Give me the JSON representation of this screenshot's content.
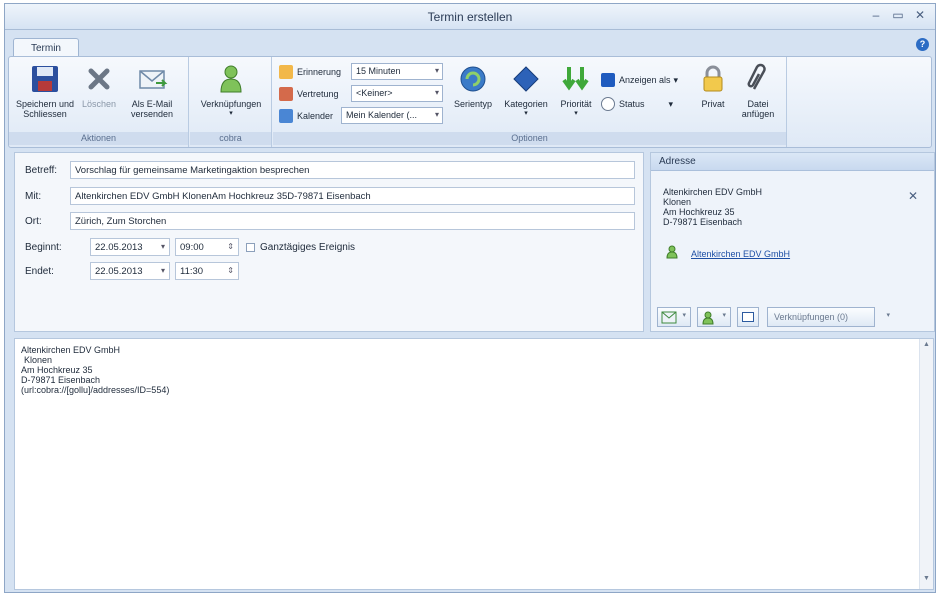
{
  "window": {
    "title": "Termin erstellen",
    "controls": [
      "–",
      "▭",
      "✕"
    ]
  },
  "tabs": {
    "active": "Termin",
    "help": "?"
  },
  "ribbon": {
    "aktionen": {
      "label": "Aktionen",
      "save": "Speichern und\nSchliessen",
      "delete": "Löschen",
      "email": "Als E-Mail\nversenden"
    },
    "cobra": {
      "label": "cobra",
      "links": "Verknüpfungen"
    },
    "optionen": {
      "label": "Optionen",
      "reminder_label": "Erinnerung",
      "reminder_value": "15 Minuten",
      "substitute_label": "Vertretung",
      "substitute_value": "<Keiner>",
      "calendar_label": "Kalender",
      "calendar_value": "Mein Kalender (...",
      "series": "Serientyp",
      "categories": "Kategorien",
      "priority": "Priorität",
      "show_as": "Anzeigen als",
      "status": "Status",
      "private": "Privat",
      "attach": "Datei\nanfügen"
    }
  },
  "form": {
    "subject_label": "Betreff:",
    "subject_value": "Vorschlag für gemeinsame Marketingaktion besprechen",
    "with_label": "Mit:",
    "with_value": "Altenkirchen EDV GmbH KlonenAm Hochkreuz 35D-79871 Eisenbach",
    "location_label": "Ort:",
    "location_value": "Zürich, Zum Storchen",
    "start_label": "Beginnt:",
    "start_date": "22.05.2013",
    "start_time": "09:00",
    "allday_label": "Ganztägiges Ereignis",
    "end_label": "Endet:",
    "end_date": "22.05.2013",
    "end_time": "11:30"
  },
  "address": {
    "header": "Adresse",
    "line1": "Altenkirchen EDV GmbH",
    "line2": "Klonen",
    "line3": "Am Hochkreuz 35",
    "line4": "D-79871 Eisenbach",
    "link": "Altenkirchen EDV GmbH",
    "links_button": "Verknüpfungen (0)"
  },
  "notes": {
    "line1": "Altenkirchen EDV GmbH",
    "line2": "Klonen",
    "line3": "Am Hochkreuz 35",
    "line4": "D-79871 Eisenbach",
    "line5": "(url:cobra://[gollu]/addresses/ID=554)"
  }
}
